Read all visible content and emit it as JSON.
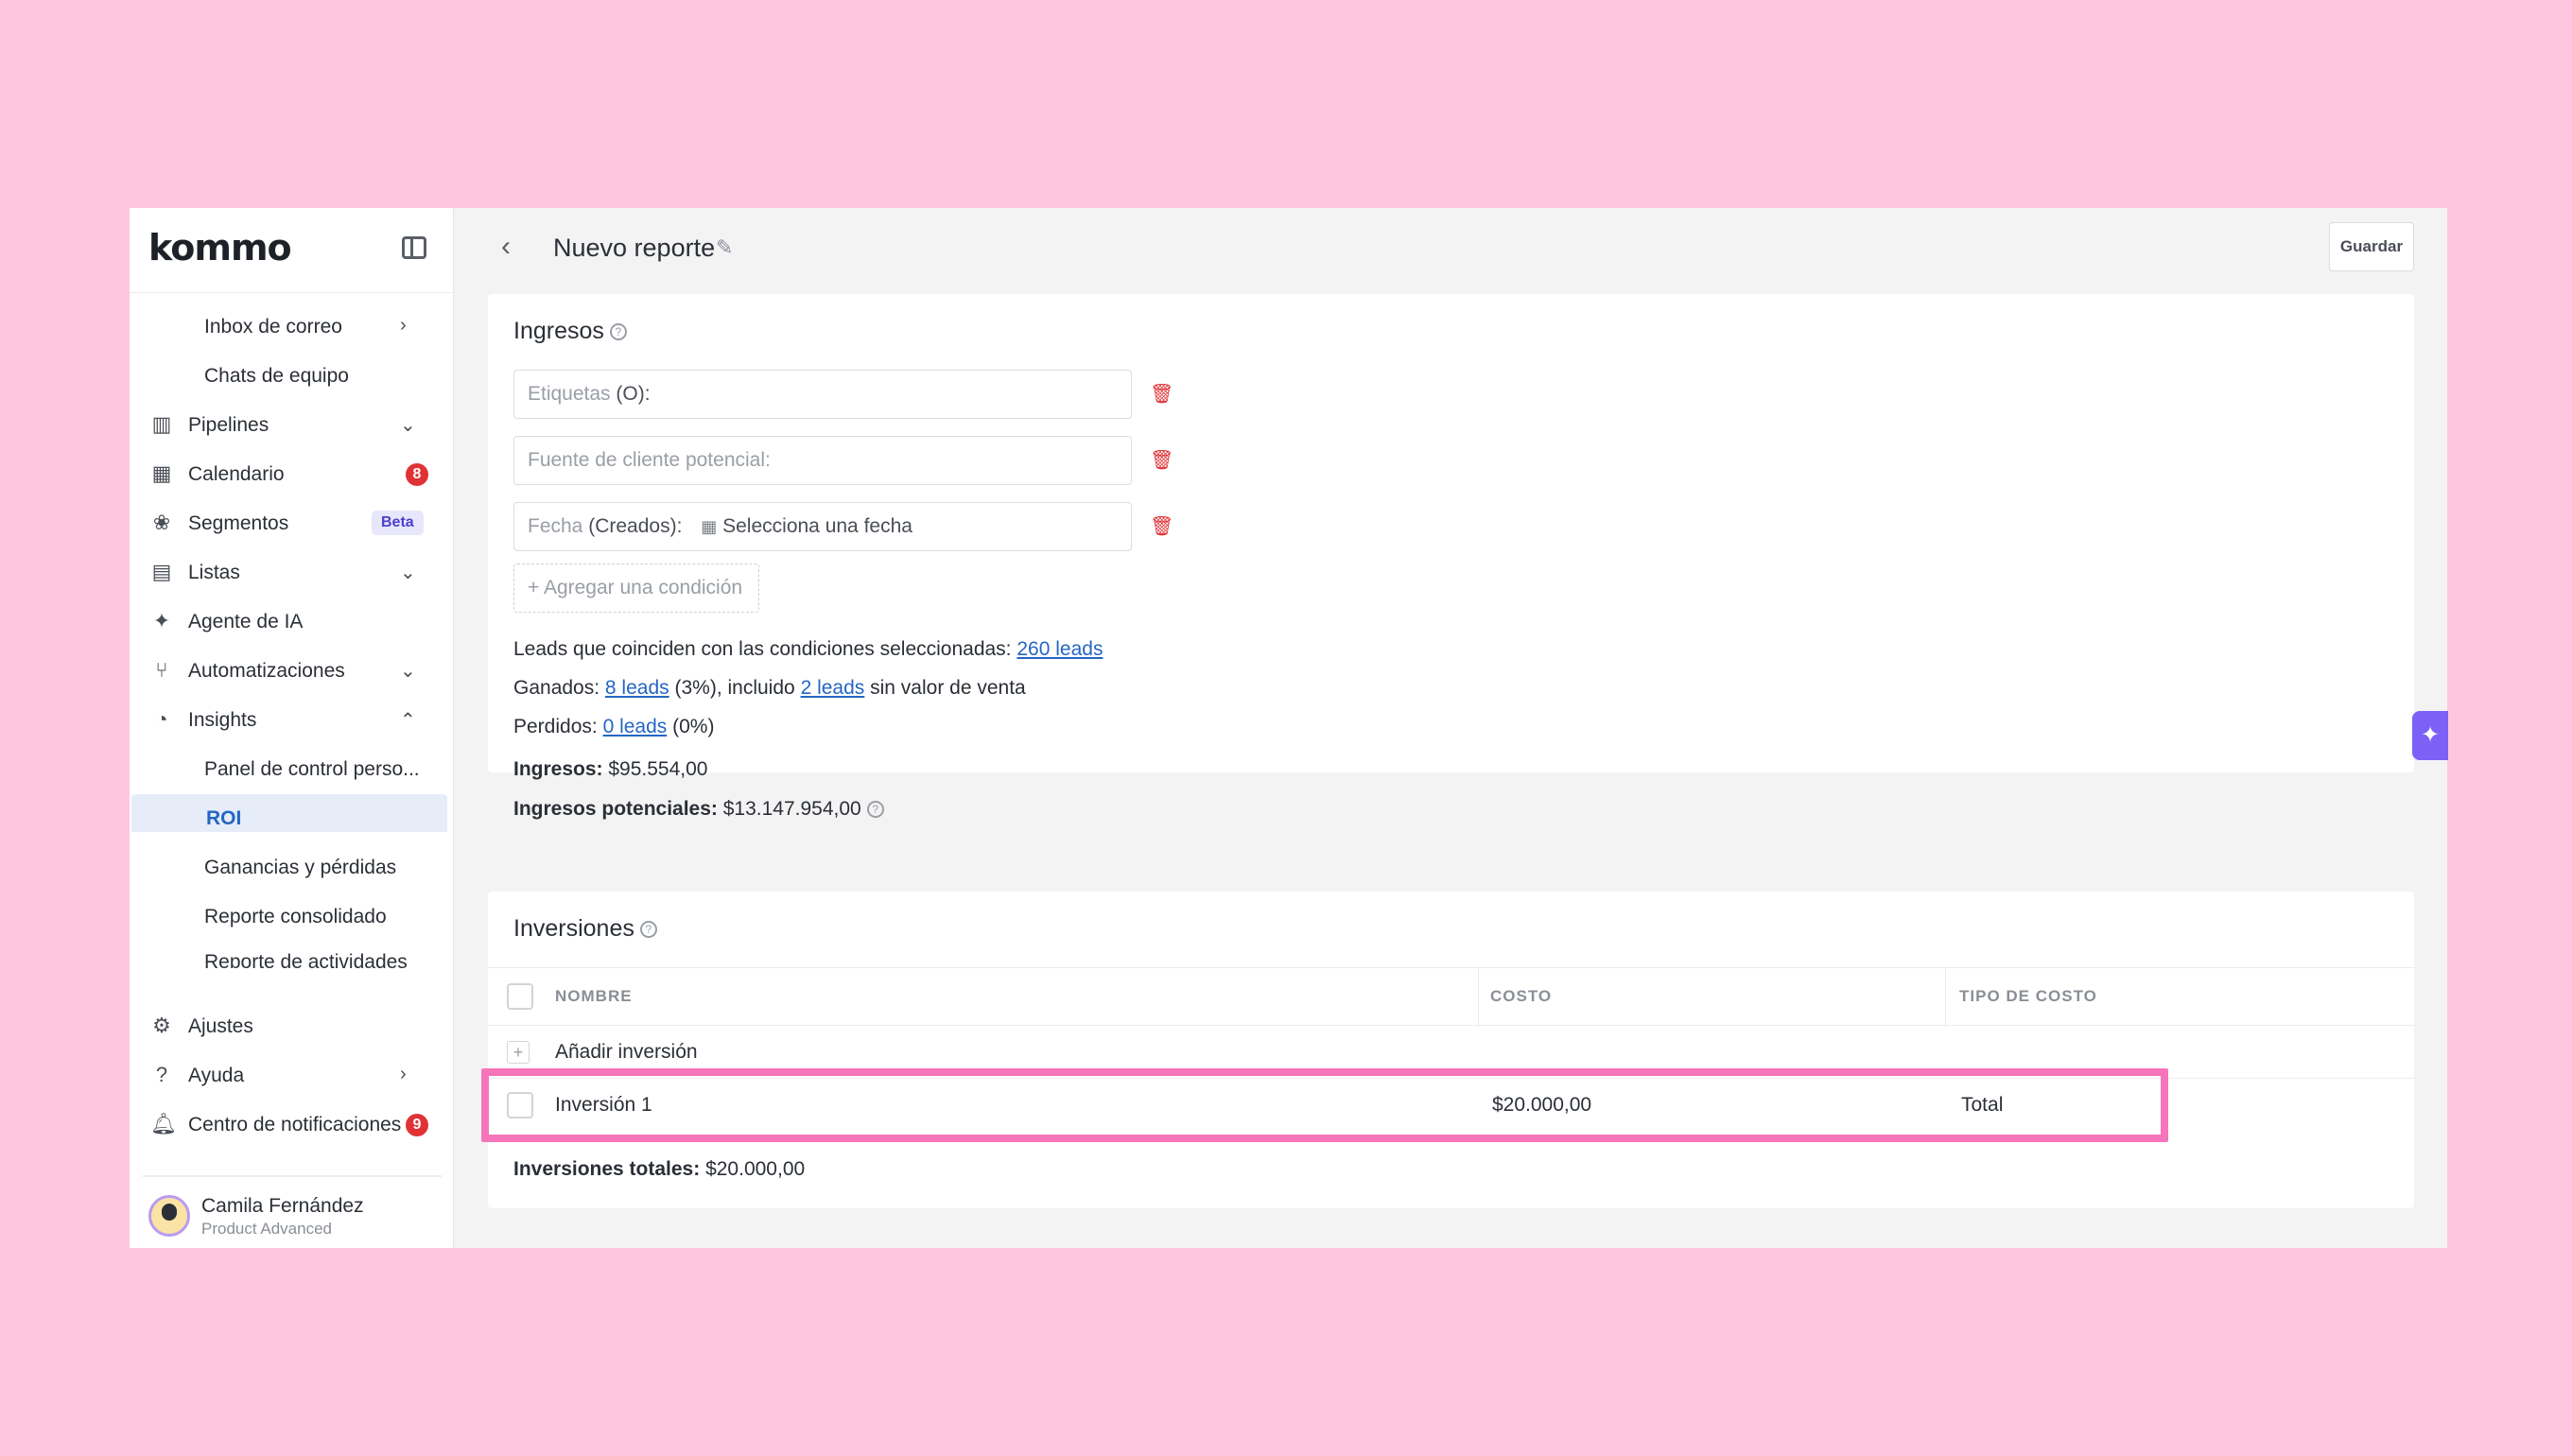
{
  "brand": {
    "logo": "kommo"
  },
  "sidebar": {
    "items": [
      {
        "label": "Inbox de correo",
        "icon": "",
        "sub": true
      },
      {
        "label": "Chats de equipo",
        "icon": "",
        "sub": true
      },
      {
        "label": "Pipelines",
        "icon": "pipelines-icon"
      },
      {
        "label": "Calendario",
        "icon": "calendar-icon",
        "badge": "8"
      },
      {
        "label": "Segmentos",
        "icon": "segments-icon",
        "badge": "Beta"
      },
      {
        "label": "Listas",
        "icon": "list-icon"
      },
      {
        "label": "Agente de IA",
        "icon": "sparkle-icon"
      },
      {
        "label": "Automatizaciones",
        "icon": "automation-icon"
      },
      {
        "label": "Insights",
        "icon": "insights-icon"
      },
      {
        "label": "Panel de control perso...",
        "sub": true
      },
      {
        "label": "ROI",
        "sub": true,
        "active": true
      },
      {
        "label": "Ganancias y pérdidas",
        "sub": true
      },
      {
        "label": "Reporte consolidado",
        "sub": true
      },
      {
        "label": "Reporte de actividades",
        "sub": true
      }
    ],
    "bottom": [
      {
        "label": "Ajustes",
        "icon": "settings-icon"
      },
      {
        "label": "Ayuda",
        "icon": "help-icon"
      },
      {
        "label": "Centro de notificaciones",
        "icon": "bell-icon",
        "badge": "9"
      }
    ],
    "user": {
      "name": "Camila Fernández",
      "role": "Product Advanced"
    }
  },
  "header": {
    "title": "Nuevo reporte",
    "save_label": "Guardar"
  },
  "ingresos": {
    "title": "Ingresos",
    "filters": [
      {
        "label": "Etiquetas",
        "value": "(O):",
        "date": ""
      },
      {
        "label": "Fuente de cliente potencial:",
        "value": "",
        "date": ""
      },
      {
        "label": "Fecha",
        "value": "(Creados):",
        "date": "Selecciona una fecha"
      }
    ],
    "add_condition": "+ Agregar una condición",
    "match_text": "Leads que coinciden con las condiciones seleccionadas:",
    "match_link": "260 leads",
    "won_label": "Ganados:",
    "won_link": "8 leads",
    "won_mid": "(3%), incluido",
    "won_link2": "2 leads",
    "won_tail": "sin valor de venta",
    "lost_label": "Perdidos:",
    "lost_link": "0 leads",
    "lost_tail": "(0%)",
    "revenue_label": "Ingresos:",
    "revenue_value": "$95.554,00",
    "potential_label": "Ingresos potenciales:",
    "potential_value": "$13.147.954,00"
  },
  "inversiones": {
    "title": "Inversiones",
    "columns": [
      "NOMBRE",
      "COSTO",
      "TIPO DE COSTO"
    ],
    "add_label": "Añadir inversión",
    "rows": [
      {
        "name": "Inversión 1",
        "cost": "$20.000,00",
        "type": "Total"
      }
    ],
    "total_label": "Inversiones totales:",
    "total_value": "$20.000,00"
  },
  "colors": {
    "accent": "#2466c4",
    "highlight": "#f674b9",
    "background": "#ffc6e0"
  }
}
